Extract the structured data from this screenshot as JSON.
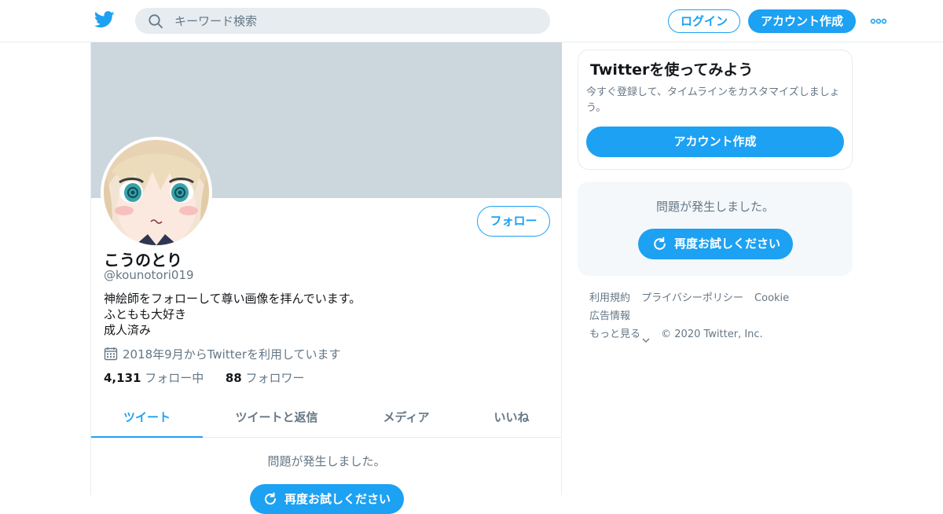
{
  "colors": {
    "accent": "#1da1f2",
    "banner": "#ccd6dd",
    "muted": "#657786",
    "border": "#e6ecf0"
  },
  "header": {
    "logo_icon": "twitter-bird-icon",
    "search": {
      "placeholder": "キーワード検索",
      "icon": "search-icon"
    },
    "login_label": "ログイン",
    "signup_label": "アカウント作成",
    "more_icon": "more-dots-icon"
  },
  "profile": {
    "display_name": "こうのとり",
    "handle": "@kounotori019",
    "follow_label": "フォロー",
    "bio_lines": [
      "神絵師をフォローして尊い画像を拝んでいます。",
      "ふともも大好き",
      "成人済み"
    ],
    "joined": "2018年9月からTwitterを利用しています",
    "following_count": "4,131",
    "following_label": "フォロー中",
    "followers_count": "88",
    "followers_label": "フォロワー"
  },
  "tabs": [
    {
      "label": "ツイート",
      "active": true
    },
    {
      "label": "ツイートと返信",
      "active": false
    },
    {
      "label": "メディア",
      "active": false
    },
    {
      "label": "いいね",
      "active": false
    }
  ],
  "main_error": {
    "message": "問題が発生しました。",
    "retry_label": "再度お試しください"
  },
  "sidebar": {
    "signup_card": {
      "title": "Twitterを使ってみよう",
      "description": "今すぐ登録して、タイムラインをカスタマイズしましょう。",
      "button_label": "アカウント作成"
    },
    "error_box": {
      "message": "問題が発生しました。",
      "retry_label": "再度お試しください"
    },
    "footer": {
      "links": [
        "利用規約",
        "プライバシーポリシー",
        "Cookie",
        "広告情報"
      ],
      "more_label": "もっと見る",
      "copyright": "© 2020 Twitter, Inc."
    }
  }
}
